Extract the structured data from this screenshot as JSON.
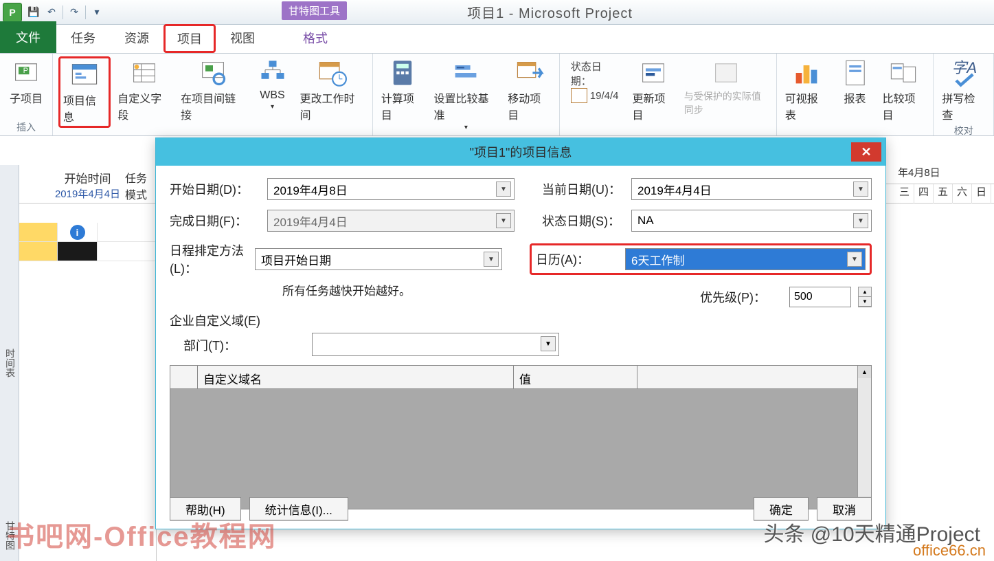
{
  "titlebar": {
    "app_title": "项目1 - Microsoft Project",
    "contextual_tab": "甘特图工具"
  },
  "tabs": {
    "file": "文件",
    "task": "任务",
    "resource": "资源",
    "project": "项目",
    "view": "视图",
    "format": "格式"
  },
  "ribbon": {
    "insert_group": "插入",
    "subproject": "子项目",
    "project_info": "项目信息",
    "custom_fields": "自定义字段",
    "link_projects": "在项目间链接",
    "wbs": "WBS",
    "change_work_time": "更改工作时间",
    "calc_project": "计算项目",
    "set_baseline": "设置比较基准",
    "move_project": "移动项目",
    "status_date_label": "状态日期：",
    "status_date_value": "19/4/4",
    "update_project": "更新项目",
    "sync_protected": "与受保护的实际值同步",
    "visual_reports": "可视报表",
    "reports": "报表",
    "compare_projects": "比较项目",
    "spelling": "拼写检查",
    "proofing_group": "校对"
  },
  "sheet": {
    "vtab_top": "时间表",
    "vtab_bottom": "甘特图",
    "start_time_header": "开始时间",
    "start_time_value": "2019年4月4日",
    "task_mode_col": "任务模式",
    "gantt_week": "年4月8日",
    "days": [
      "三",
      "四",
      "五",
      "六",
      "日"
    ]
  },
  "dialog": {
    "title": "\"项目1\"的项目信息",
    "start_date_lbl": "开始日期(D)：",
    "start_date_val": "2019年4月8日",
    "finish_date_lbl": "完成日期(F)：",
    "finish_date_val": "2019年4月4日",
    "schedule_from_lbl": "日程排定方法(L)：",
    "schedule_from_val": "项目开始日期",
    "note": "所有任务越快开始越好。",
    "current_date_lbl": "当前日期(U)：",
    "current_date_val": "2019年4月4日",
    "status_date_lbl": "状态日期(S)：",
    "status_date_val": "NA",
    "calendar_lbl": "日历(A)：",
    "calendar_val": "6天工作制",
    "priority_lbl": "优先级(P)：",
    "priority_val": "500",
    "enterprise_lbl": "企业自定义域(E)",
    "department_lbl": "部门(T)：",
    "grid_col1": "自定义域名",
    "grid_col2": "值",
    "help_btn": "帮助(H)",
    "stats_btn": "统计信息(I)...",
    "ok_btn": "确定",
    "cancel_btn": "取消"
  },
  "watermarks": {
    "w1": "书吧网-Office教程网",
    "w2": "头条 @10天精通Project",
    "w3": "office66.cn"
  }
}
